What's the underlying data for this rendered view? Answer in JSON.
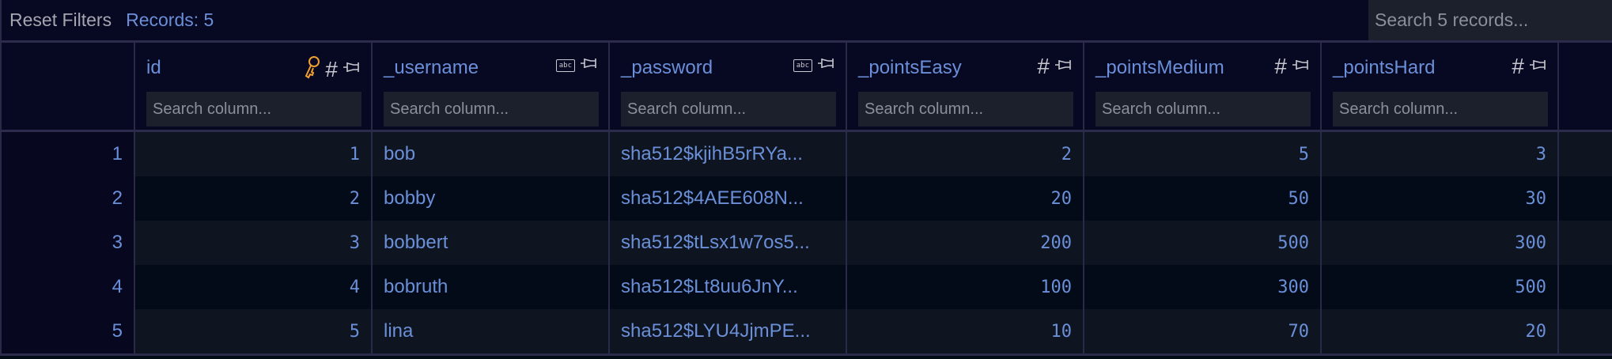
{
  "toolbar": {
    "reset_label": "Reset Filters",
    "records_label": "Records: 5",
    "search_placeholder": "Search 5 records..."
  },
  "columns": [
    {
      "name": "id",
      "type_icon": "hash-icon",
      "key": true
    },
    {
      "name": "_username",
      "type_icon": "abc-icon"
    },
    {
      "name": "_password",
      "type_icon": "abc-icon"
    },
    {
      "name": "_pointsEasy",
      "type_icon": "hash-icon"
    },
    {
      "name": "_pointsMedium",
      "type_icon": "hash-icon"
    },
    {
      "name": "_pointsHard",
      "type_icon": "hash-icon"
    }
  ],
  "column_search_placeholder": "Search column...",
  "icons": {
    "hash": "#",
    "abc": "abc",
    "key_color": "#f0a030"
  },
  "rows": [
    {
      "n": "1",
      "id": "1",
      "username": "bob",
      "password": "sha512$kjihB5rRYa...",
      "easy": "2",
      "medium": "5",
      "hard": "3"
    },
    {
      "n": "2",
      "id": "2",
      "username": "bobby",
      "password": "sha512$4AEE608N...",
      "easy": "20",
      "medium": "50",
      "hard": "30"
    },
    {
      "n": "3",
      "id": "3",
      "username": "bobbert",
      "password": "sha512$tLsx1w7os5...",
      "easy": "200",
      "medium": "500",
      "hard": "300"
    },
    {
      "n": "4",
      "id": "4",
      "username": "bobruth",
      "password": "sha512$Lt8uu6JnY...",
      "easy": "100",
      "medium": "300",
      "hard": "500"
    },
    {
      "n": "5",
      "id": "5",
      "username": "lina",
      "password": "sha512$LYU4JjmPE...",
      "easy": "10",
      "medium": "70",
      "hard": "20"
    }
  ]
}
